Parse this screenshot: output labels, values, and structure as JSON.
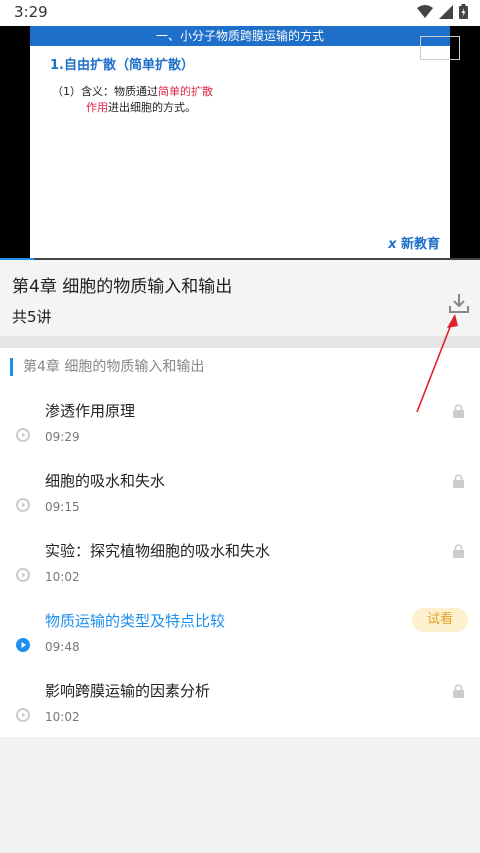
{
  "status": {
    "time": "3:29"
  },
  "slide": {
    "header": "一、小分子物质跨膜运输的方式",
    "heading": "1.自由扩散（简单扩散）",
    "line1_prefix": "（1）含义：物质通过",
    "line1_red": "简单的扩散",
    "line2_red": "作用",
    "line2_rest": "进出细胞的方式。",
    "logo": "新教育"
  },
  "video": {
    "progress_fraction": 0.07
  },
  "course": {
    "title": "第4章 细胞的物质输入和输出",
    "count": "共5讲"
  },
  "section": {
    "title": "第4章 细胞的物质输入和输出"
  },
  "lessons": [
    {
      "name": "渗透作用原理",
      "duration": "09:29",
      "locked": true
    },
    {
      "name": "细胞的吸水和失水",
      "duration": "09:15",
      "locked": true
    },
    {
      "name": "实验：探究植物细胞的吸水和失水",
      "duration": "10:02",
      "locked": true
    },
    {
      "name": "物质运输的类型及特点比较",
      "duration": "09:48",
      "locked": false,
      "badge": "试看",
      "active": true
    },
    {
      "name": "影响跨膜运输的因素分析",
      "duration": "10:02",
      "locked": true
    }
  ],
  "colors": {
    "accent": "#1e8ff0",
    "annotation": "#e0202a",
    "badge_bg": "#fdf0cf"
  }
}
